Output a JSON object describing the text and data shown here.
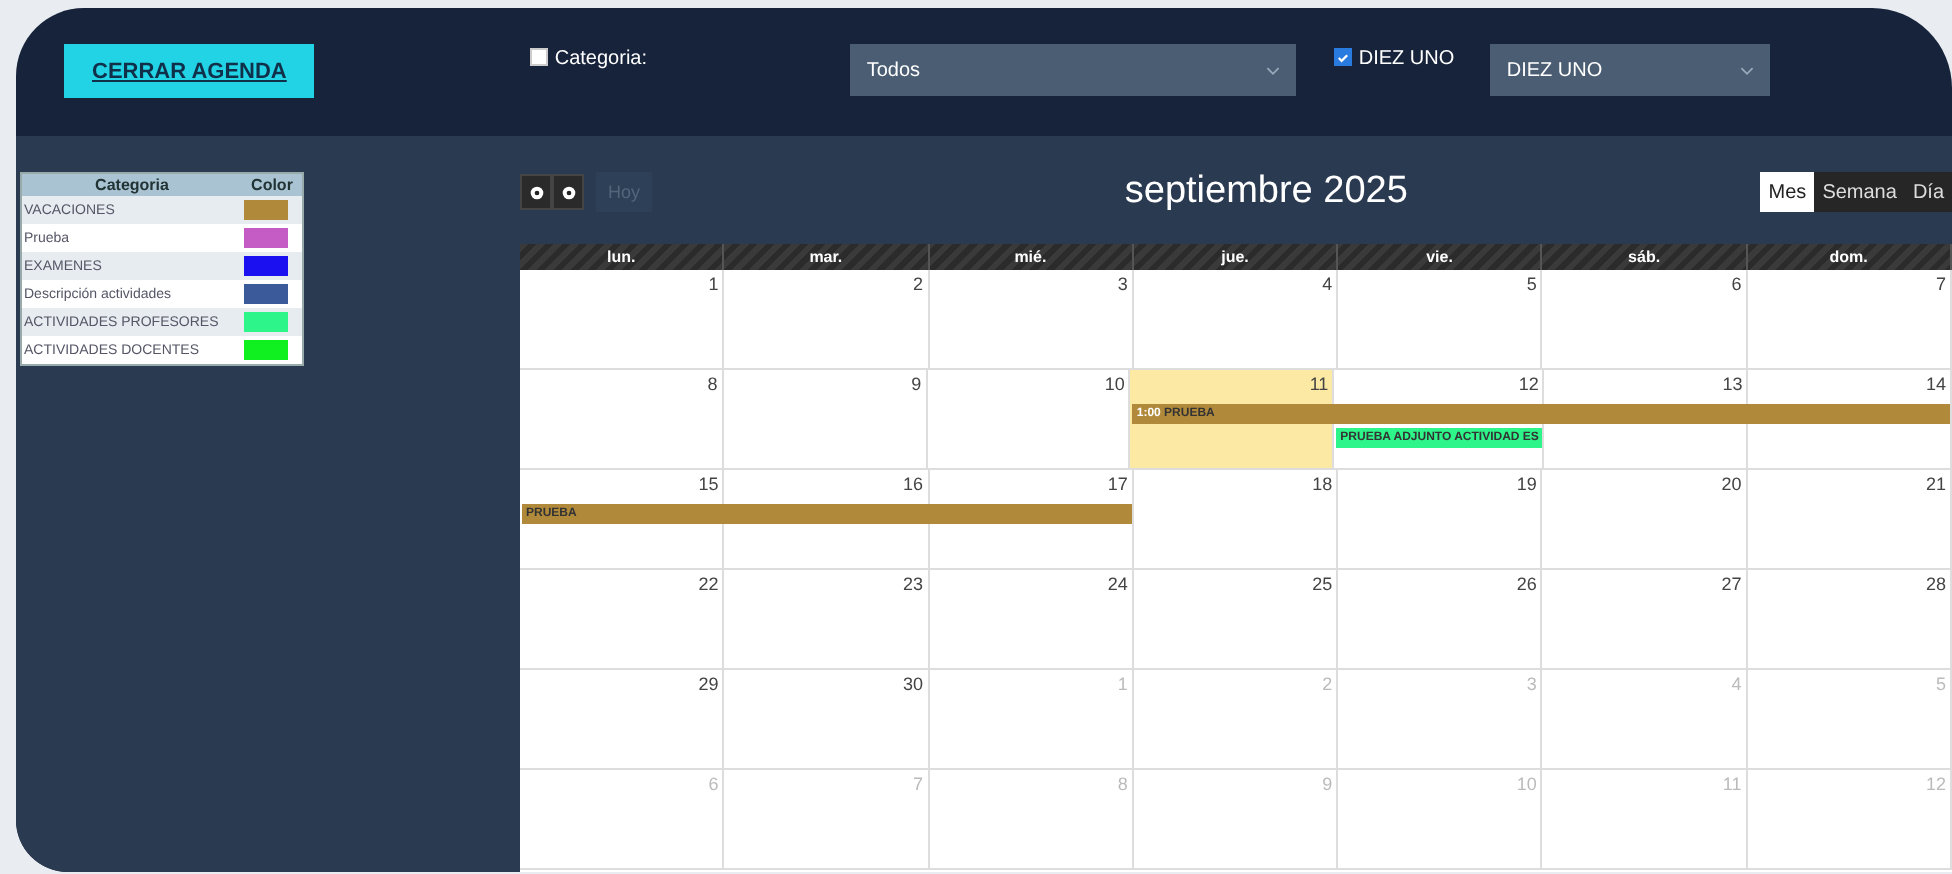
{
  "header": {
    "close_button": "CERRAR AGENDA",
    "category_filter": {
      "label": "Categoria:",
      "checked": false,
      "dropdown": "Todos"
    },
    "group_filter": {
      "label": "DIEZ UNO",
      "checked": true,
      "dropdown": "DIEZ UNO"
    }
  },
  "legend": {
    "columns": [
      "Categoria",
      "Color"
    ],
    "items": [
      {
        "name": "VACACIONES",
        "color": "#b08a3a"
      },
      {
        "name": "Prueba",
        "color": "#c55cc5"
      },
      {
        "name": "EXAMENES",
        "color": "#1a10f0"
      },
      {
        "name": "Descripción actividades",
        "color": "#3a5a9a"
      },
      {
        "name": "ACTIVIDADES PROFESORES",
        "color": "#2ef58a"
      },
      {
        "name": "ACTIVIDADES DOCENTES",
        "color": "#10f020"
      }
    ]
  },
  "calendar": {
    "today_button": {
      "label": "Hoy",
      "disabled": true
    },
    "title": "septiembre 2025",
    "views": [
      {
        "label": "Mes",
        "selected": true
      },
      {
        "label": "Semana",
        "selected": false
      },
      {
        "label": "Día",
        "selected": false
      }
    ],
    "weekdays": [
      "lun.",
      "mar.",
      "mié.",
      "jue.",
      "vie.",
      "sáb.",
      "dom."
    ],
    "weeks": [
      {
        "days": [
          {
            "n": "1",
            "other": false,
            "today": false
          },
          {
            "n": "2",
            "other": false,
            "today": false
          },
          {
            "n": "3",
            "other": false,
            "today": false
          },
          {
            "n": "4",
            "other": false,
            "today": false
          },
          {
            "n": "5",
            "other": false,
            "today": false
          },
          {
            "n": "6",
            "other": false,
            "today": false
          },
          {
            "n": "7",
            "other": false,
            "today": false
          }
        ]
      },
      {
        "days": [
          {
            "n": "8",
            "other": false,
            "today": false
          },
          {
            "n": "9",
            "other": false,
            "today": false
          },
          {
            "n": "10",
            "other": false,
            "today": false
          },
          {
            "n": "11",
            "other": false,
            "today": true
          },
          {
            "n": "12",
            "other": false,
            "today": false
          },
          {
            "n": "13",
            "other": false,
            "today": false
          },
          {
            "n": "14",
            "other": false,
            "today": false
          }
        ],
        "events": [
          {
            "time": "1:00",
            "title": "PRUEBA",
            "color": "#b08a3a"
          },
          {
            "title": "PRUEBA ADJUNTO ACTIVIDAD ES",
            "color": "#2ef58a"
          }
        ]
      },
      {
        "days": [
          {
            "n": "15",
            "other": false,
            "today": false
          },
          {
            "n": "16",
            "other": false,
            "today": false
          },
          {
            "n": "17",
            "other": false,
            "today": false
          },
          {
            "n": "18",
            "other": false,
            "today": false
          },
          {
            "n": "19",
            "other": false,
            "today": false
          },
          {
            "n": "20",
            "other": false,
            "today": false
          },
          {
            "n": "21",
            "other": false,
            "today": false
          }
        ],
        "events": [
          {
            "title": "PRUEBA",
            "color": "#b08a3a"
          }
        ]
      },
      {
        "days": [
          {
            "n": "22",
            "other": false,
            "today": false
          },
          {
            "n": "23",
            "other": false,
            "today": false
          },
          {
            "n": "24",
            "other": false,
            "today": false
          },
          {
            "n": "25",
            "other": false,
            "today": false
          },
          {
            "n": "26",
            "other": false,
            "today": false
          },
          {
            "n": "27",
            "other": false,
            "today": false
          },
          {
            "n": "28",
            "other": false,
            "today": false
          }
        ]
      },
      {
        "days": [
          {
            "n": "29",
            "other": false,
            "today": false
          },
          {
            "n": "30",
            "other": false,
            "today": false
          },
          {
            "n": "1",
            "other": true,
            "today": false
          },
          {
            "n": "2",
            "other": true,
            "today": false
          },
          {
            "n": "3",
            "other": true,
            "today": false
          },
          {
            "n": "4",
            "other": true,
            "today": false
          },
          {
            "n": "5",
            "other": true,
            "today": false
          }
        ]
      },
      {
        "days": [
          {
            "n": "6",
            "other": true,
            "today": false
          },
          {
            "n": "7",
            "other": true,
            "today": false
          },
          {
            "n": "8",
            "other": true,
            "today": false
          },
          {
            "n": "9",
            "other": true,
            "today": false
          },
          {
            "n": "10",
            "other": true,
            "today": false
          },
          {
            "n": "11",
            "other": true,
            "today": false
          },
          {
            "n": "12",
            "other": true,
            "today": false
          }
        ]
      }
    ]
  }
}
